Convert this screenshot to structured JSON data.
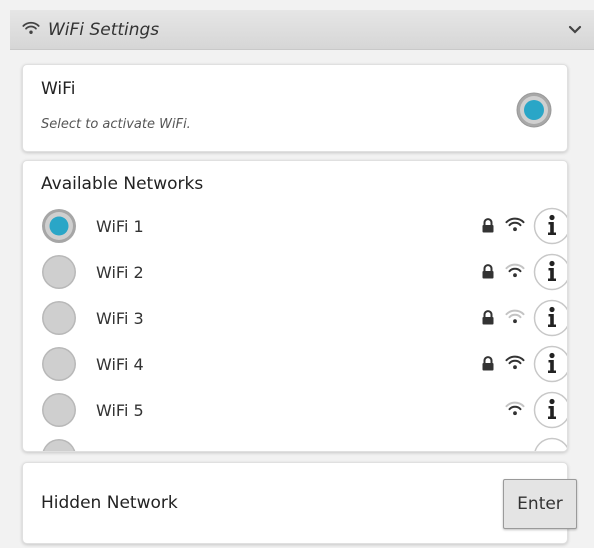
{
  "header": {
    "title": "WiFi Settings"
  },
  "wifi_card": {
    "name": "WiFi",
    "subtitle": "Select to activate WiFi."
  },
  "networks_card": {
    "heading": "Available Networks",
    "networks": [
      {
        "label": "WiFi 1",
        "selected": true
      },
      {
        "label": "WiFi 2",
        "selected": false
      },
      {
        "label": "WiFi 3",
        "selected": false
      },
      {
        "label": "WiFi 4",
        "selected": false
      },
      {
        "label": "WiFi 5",
        "selected": false
      }
    ]
  },
  "hidden_card": {
    "name": "Hidden Network",
    "button": "Enter"
  },
  "colors": {
    "accent": "#2aa6c7",
    "radio_off": "#cfcfcf",
    "header_bg": "#dcdcdc"
  }
}
